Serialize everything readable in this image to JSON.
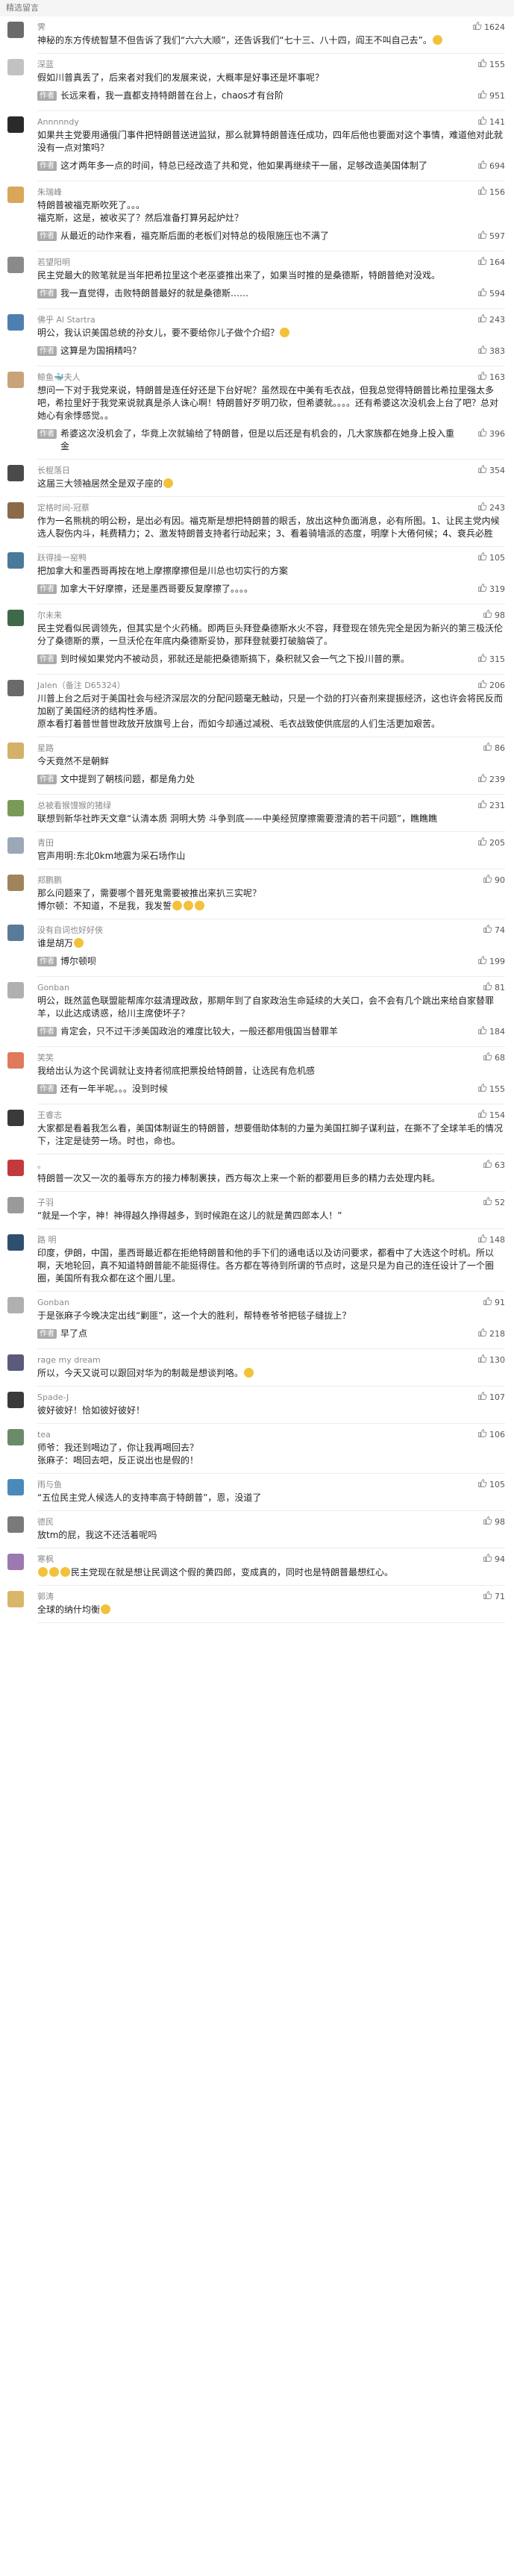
{
  "header": {
    "title": "精选留言"
  },
  "comments": [
    {
      "username": "霁",
      "avatar_color": "#6b6b6b",
      "likes": "1624",
      "text": "神秘的东方传统智慧不但告诉了我们“六六大顺”，还告诉我们“七十三、八十四，阎王不叫自己去”。",
      "emojis": 1
    },
    {
      "username": "深蓝",
      "avatar_color": "#c2c2c2",
      "likes": "155",
      "text": "假如川普真丢了，后来者对我们的发展来说，大概率是好事还是坏事呢？",
      "reply": {
        "label": "作者",
        "text": "长远来看，我一直都支持特朗普在台上，chaos才有台阶",
        "likes": "951"
      }
    },
    {
      "username": "Annnnndy",
      "avatar_color": "#2a2a2a",
      "likes": "141",
      "text": "如果共主党要用通俄门事件把特朗普送进监狱，那么就算特朗普连任成功，四年后他也要面对这个事情，难道他对此就没有一点对策吗？",
      "reply": {
        "label": "作者",
        "text": "这才两年多一点的时间，特总已经改造了共和党，他如果再继续干一届，足够改造美国体制了",
        "likes": "694"
      }
    },
    {
      "username": "朱瑞峰",
      "avatar_color": "#d9a65a",
      "likes": "156",
      "text": "特朗普被福克斯吹死了。。。\n福克斯，这是，被收买了？然后准备打算另起炉灶？",
      "reply": {
        "label": "作者",
        "text": "从最近的动作来看，福克斯后面的老板们对特总的极限施压也不满了",
        "likes": "597"
      }
    },
    {
      "username": "若望阳明",
      "avatar_color": "#8a8a8a",
      "likes": "164",
      "text": "民主党最大的败笔就是当年把希拉里这个老巫婆推出来了，如果当时推的是桑德斯，特朗普绝对没戏。",
      "reply": {
        "label": "作者",
        "text": "我一直觉得，击败特朗普最好的就是桑德斯……",
        "likes": "594"
      }
    },
    {
      "username": "佛乎 Al Startra",
      "avatar_color": "#4f7fb0",
      "likes": "243",
      "text": "明公，我认识美国总统的孙女儿，要不要给你儿子做个介绍？",
      "emojis": 1,
      "reply": {
        "label": "作者",
        "text": "这算是为国捐精吗？",
        "likes": "383"
      }
    },
    {
      "username": "鲸鱼🐳夫人",
      "avatar_color": "#caa27a",
      "likes": "163",
      "text": "想问一下对于我党来说，特朗普是连任好还是下台好呢？虽然现在中美有毛衣战，但我总觉得特朗普比希拉里强太多吧，希拉里好于我党来说就真是杀人诛心啊！特朗普好歹明刀砍，但希婆就。。。。还有希婆这次没机会上台了吧？总对她心有余悸感觉。。",
      "reply": {
        "label": "作者",
        "text": "希婆这次没机会了，华竟上次就输给了特朗普，但是以后还是有机会的，几大家族都在她身上投入重金",
        "likes": "396"
      }
    },
    {
      "username": "长棍落日",
      "avatar_color": "#4a4a4a",
      "likes": "354",
      "text": "这届三大领袖居然全是双子座的",
      "emojis": 1
    },
    {
      "username": "定格时间-冠蔡",
      "avatar_color": "#8a6a4a",
      "likes": "243",
      "text": "作为一名熊桃的明公粉，是出必有因。福克斯是想把特朗普的眼舌，放出这种负面消息，必有所图。1、让民主党内候选人裂伤内斗，耗费精力；2、激发特朗普支持者行动起来；3、看着骑墙派的态度，明摩卜大倦何候；4、衰兵必胜"
    },
    {
      "username": "跃得操一窑鸭",
      "avatar_color": "#4a7a9a",
      "likes": "105",
      "text": "把加拿大和墨西哥再按在地上摩擦摩擦但是川总也切实行的方案",
      "reply": {
        "label": "作者",
        "text": "加拿大干好摩擦，还是墨西哥要反复摩擦了。。。。",
        "likes": "319"
      }
    },
    {
      "username": "尔未来",
      "avatar_color": "#3e6a4a",
      "likes": "98",
      "text": "民主党看似民调领先，但其实是个火药桶。即两巨头拜登桑德斯水火不容，拜登现在领先完全是因为新兴的第三极沃伦分了桑德斯的票，一旦沃伦在年底内桑德斯妥协，那拜登就要打破脑袋了。",
      "reply": {
        "label": "作者",
        "text": "到时候如果党内不被动员，邪就还是能把桑德斯搞下，桑积就又会一气之下投川普的票。",
        "likes": "315"
      }
    },
    {
      "username": "Jalen（备注 D65324）",
      "avatar_color": "#6a6a6a",
      "likes": "206",
      "text": "川普上台之后对于美国社会与经济深层次的分配问题毫无触动，只是一个劲的打兴奋剂来提振经济，这也许会将民反而加剧了美国经济的结构性矛盾。\n原本看打着普世普世政放开放旗号上台，而如今却通过减税、毛衣战致使供底层的人们生活更加艰苦。"
    },
    {
      "username": "星路",
      "avatar_color": "#d4b06a",
      "likes": "86",
      "text": "今天竟然不是朝鲜",
      "reply": {
        "label": "作者",
        "text": "文中提到了朝核问题，都是角力处",
        "likes": "239"
      }
    },
    {
      "username": "总被看猴馒猴的猪绿",
      "avatar_color": "#7a9a5a",
      "likes": "231",
      "text": "联想到新华社昨天文章“认清本质 洞明大势 斗争到底——中美经贸摩擦需要澄清的若干问题”，瞧瞧瞧"
    },
    {
      "username": "青田",
      "avatar_color": "#9aa8b8",
      "likes": "205",
      "text": "官声用明:东北0km地震为采石场作山"
    },
    {
      "username": "郑鹏鹏",
      "avatar_color": "#a0845a",
      "likes": "90",
      "text": "那么问题来了，需要哪个普死鬼需要被推出来扒三实呢？\n博尔顿：不知道，不是我，我发誓",
      "emojis": 3
    },
    {
      "username": "没有自词也好好俠",
      "avatar_color": "#5a7a9a",
      "likes": "74",
      "text": "谁是胡万",
      "emojis": 1,
      "reply": {
        "label": "作者",
        "text": "博尔顿呗",
        "likes": "199"
      }
    },
    {
      "username": "Gonban",
      "avatar_color": "#b0b0b0",
      "likes": "81",
      "text": "明公，既然蓝色联盟能帮库尔兹清理政敌，那期年到了自家政治生命延续的大关口，会不会有几个跳出来给自家替罪羊，以此达成诱惑，给川主席使坏子？",
      "reply": {
        "label": "作者",
        "text": "肯定会，只不过干涉美国政治的难度比较大，一般还都用俄国当替罪羊",
        "likes": "184"
      }
    },
    {
      "username": "笑笑",
      "avatar_color": "#e07a5a",
      "likes": "68",
      "text": "我给出认为这个民调就让支持者彻底把票投给特朗普，让选民有危机感",
      "reply": {
        "label": "作者",
        "text": "还有一年半呢。。。没到时候",
        "likes": "155"
      }
    },
    {
      "username": "王睿志",
      "avatar_color": "#3a3a3a",
      "likes": "154",
      "text": "大家都是看着我怎么看，美国体制诞生的特朗普，想要借助体制的力量为美国扛脚子谋利益，在撕不了全球羊毛的情况下，注定是徒劳一场。时也，命也。"
    },
    {
      "username": "。",
      "avatar_color": "#c43a3a",
      "likes": "63",
      "text": "特朗普一次又一次的羞辱东方的接力棒制裹挟，西方每次上来一个新的都要用巨多的精力去处理内耗。"
    },
    {
      "username": "子羽",
      "avatar_color": "#9a9a9a",
      "likes": "52",
      "text": "“就是一个字，神！神得越久挣得越多，到时候跑在这儿的就是黄四郎本人！”"
    },
    {
      "username": "路 明",
      "avatar_color": "#2f4f6f",
      "likes": "148",
      "text": "印度，伊朗，中国，墨西哥最近都在拒绝特朗普和他的手下们的通电话以及访问要求，都看中了大选这个时机。所以啊，天地轮回，真不知道特朗普能不能挺得住。各方都在等待到所谓的节点时，这是只是为自己的连任设计了一个圈圈，美国所有我众都在这个圈儿里。"
    },
    {
      "username": "Gonban",
      "avatar_color": "#b0b0b0",
      "likes": "91",
      "text": "于是张麻子今晚决定出线“剿匪”，这一个大的胜利，帮特卷爷爷把毯子缝拢上？",
      "reply": {
        "label": "作者",
        "text": "早了点",
        "likes": "218"
      }
    },
    {
      "username": "rage my dream",
      "avatar_color": "#5a5a7a",
      "likes": "130",
      "text": "所以，今天又说可以跟回对华为的制裁是想谈判咯。",
      "emojis": 1
    },
    {
      "username": "Spade-J",
      "avatar_color": "#3a3a3a",
      "likes": "107",
      "text": "彼好彼好！恰如彼好彼好！"
    },
    {
      "username": "tea",
      "avatar_color": "#6a8a6a",
      "likes": "106",
      "text": "师爷：我还到喝边了，你让我再喝回去？\n张麻子：喝回去吧，反正说出也是假的！"
    },
    {
      "username": "雨与鱼",
      "avatar_color": "#4a8aba",
      "likes": "105",
      "text": "“五位民主党人候选人的支持率高于特朗普”，恩，没道了"
    },
    {
      "username": "德民",
      "avatar_color": "#7a7a7a",
      "likes": "98",
      "text": "放tm的屁，我这不还活着呢吗"
    },
    {
      "username": "寒枫",
      "avatar_color": "#9a7ab0",
      "likes": "94",
      "text": "民主党现在就是想让民调这个假的黄四郎，变成真的，同时也是特朗普最想红心。",
      "emojis_lead": 3
    },
    {
      "username": "郭涛",
      "avatar_color": "#d9b66a",
      "likes": "71",
      "text": "全球的纳什均衡",
      "emojis": 1
    }
  ]
}
